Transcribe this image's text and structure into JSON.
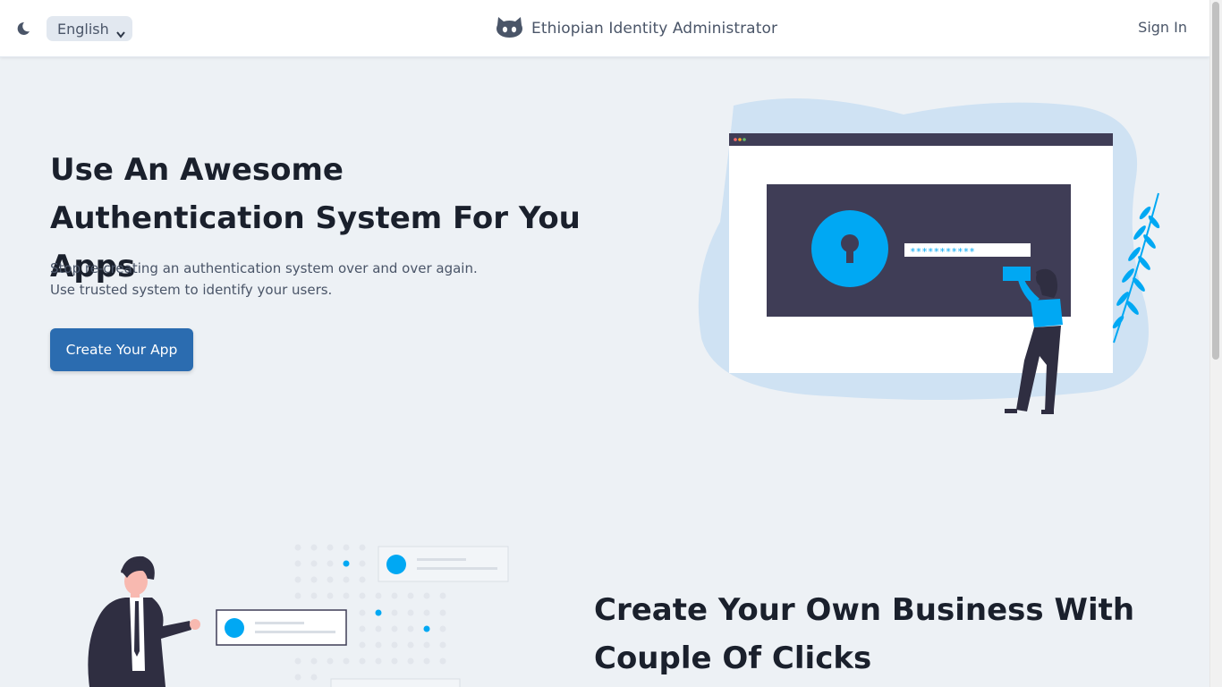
{
  "header": {
    "theme_icon": "moon-icon",
    "language": {
      "selected": "English"
    },
    "brand_icon": "github-icon",
    "brand_title": "Ethiopian Identity Administrator",
    "signin_label": "Sign In"
  },
  "hero": {
    "title": "Use An Awesome Authentication System For You Apps",
    "description_line1": "Stop re-creating an authentication system over and over again.",
    "description_line2": "Use trusted system to identify your users.",
    "cta_label": "Create Your App",
    "illustration": "authentication-illustration",
    "password_mask": "***********"
  },
  "section2": {
    "title": "Create Your Own Business With Couple Of Clicks",
    "illustration": "business-illustration"
  },
  "colors": {
    "accent": "#2b6cb0",
    "illustration_blue": "#00a8f3",
    "dark_panel": "#3f3d56",
    "background": "#edf1f5"
  }
}
